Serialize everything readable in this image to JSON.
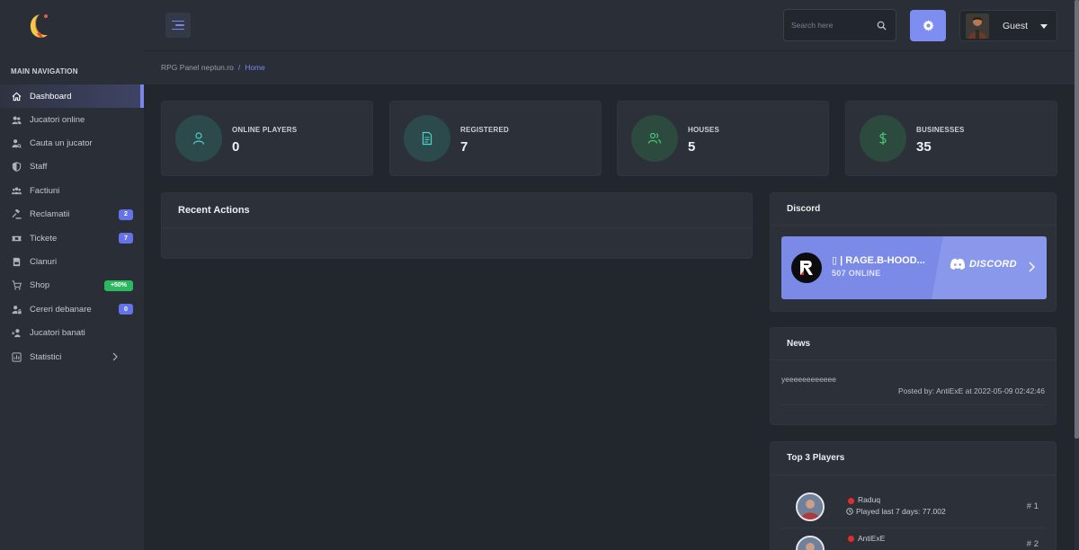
{
  "sidebar": {
    "nav_title": "MAIN NAVIGATION",
    "items": [
      {
        "label": "Dashboard",
        "icon": "home-icon",
        "active": true
      },
      {
        "label": "Jucatori online",
        "icon": "users-icon"
      },
      {
        "label": "Cauta un jucator",
        "icon": "user-search-icon"
      },
      {
        "label": "Staff",
        "icon": "shield-icon"
      },
      {
        "label": "Factiuni",
        "icon": "group-icon"
      },
      {
        "label": "Reclamatii",
        "icon": "gavel-icon",
        "badge": "2"
      },
      {
        "label": "Tickete",
        "icon": "ticket-icon",
        "badge": "7"
      },
      {
        "label": "Clanuri",
        "icon": "book-icon"
      },
      {
        "label": "Shop",
        "icon": "cart-icon",
        "badge": "+50%"
      },
      {
        "label": "Cereri debanare",
        "icon": "user-lock-icon",
        "badge": "0"
      },
      {
        "label": "Jucatori banati",
        "icon": "user-ban-icon"
      },
      {
        "label": "Statistici",
        "icon": "chart-icon"
      }
    ]
  },
  "topbar": {
    "search_placeholder": "Search here",
    "user_name": "Guest"
  },
  "breadcrumb": {
    "root": "RPG Panel neptun.ro",
    "separator": "/",
    "current": "Home"
  },
  "stats": [
    {
      "label": "ONLINE PLAYERS",
      "value": "0",
      "icon": "user-icon"
    },
    {
      "label": "REGISTERED",
      "value": "7",
      "icon": "document-icon"
    },
    {
      "label": "HOUSES",
      "value": "5",
      "icon": "users-icon"
    },
    {
      "label": "BUSINESSES",
      "value": "35",
      "icon": "dollar-icon"
    }
  ],
  "recent_actions": {
    "title": "Recent Actions"
  },
  "discord": {
    "title": "Discord",
    "server_name": "⁣▯ | RAGE.B-HOOD...",
    "online": "507 ONLINE",
    "brand": "DISCORD"
  },
  "news": {
    "title": "News",
    "text": "yeeeeeeeeeeee",
    "posted": "Posted by: AntiExE at 2022-05-09 02:42:46"
  },
  "top_players": {
    "title": "Top 3 Players",
    "players": [
      {
        "name": "Raduq",
        "played": "Played last 7 days: 77.002",
        "rank": "# 1"
      },
      {
        "name": "AntiExE",
        "played": "",
        "rank": "# 2"
      }
    ]
  },
  "colors": {
    "accent": "#7b86ea",
    "background": "#22262d",
    "card": "#2c3039",
    "sidebar": "#2a2e36",
    "offline_dot": "#e02d2d",
    "badge_green": "#2db85f"
  }
}
